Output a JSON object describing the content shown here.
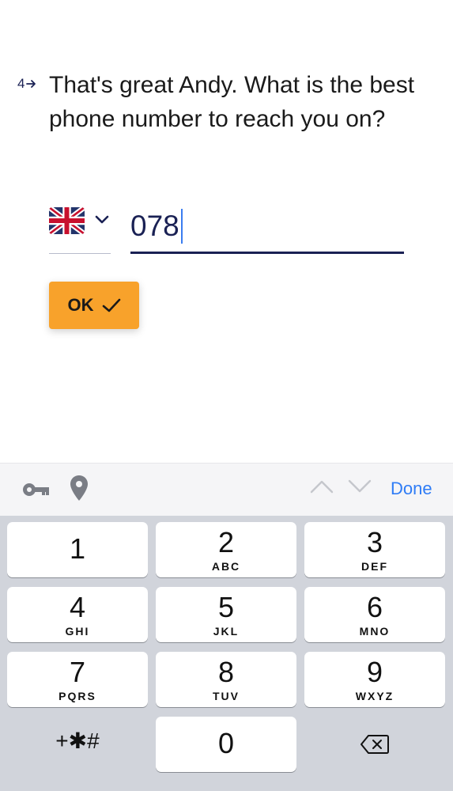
{
  "question": {
    "number": "4",
    "text": "That's great Andy. What is the best phone number to reach you on?"
  },
  "country_selector": {
    "flag_icon": "uk-flag-icon",
    "chevron_icon": "chevron-down-icon"
  },
  "phone_field": {
    "value": "078"
  },
  "ok_button": {
    "label": "OK",
    "icon": "checkmark-icon"
  },
  "toolbar": {
    "key_icon": "key-icon",
    "location_icon": "location-pin-icon",
    "prev_icon": "chevron-up-icon",
    "next_icon": "chevron-down-icon",
    "done_label": "Done"
  },
  "keypad": {
    "keys": [
      {
        "digit": "1",
        "letters": ""
      },
      {
        "digit": "2",
        "letters": "ABC"
      },
      {
        "digit": "3",
        "letters": "DEF"
      },
      {
        "digit": "4",
        "letters": "GHI"
      },
      {
        "digit": "5",
        "letters": "JKL"
      },
      {
        "digit": "6",
        "letters": "MNO"
      },
      {
        "digit": "7",
        "letters": "PQRS"
      },
      {
        "digit": "8",
        "letters": "TUV"
      },
      {
        "digit": "9",
        "letters": "WXYZ"
      }
    ],
    "symbols_label": "+✱#",
    "zero": "0",
    "delete_icon": "backspace-icon"
  },
  "colors": {
    "accent": "#f8a22b",
    "text_navy": "#1a2154",
    "done_blue": "#2f7cf6",
    "keyboard_bg": "#d1d4db"
  }
}
